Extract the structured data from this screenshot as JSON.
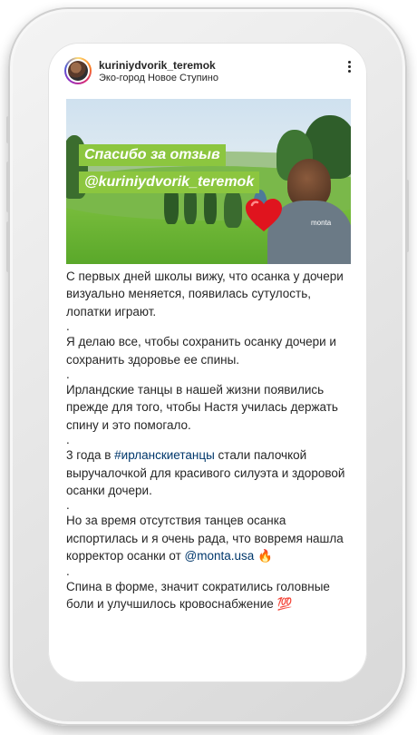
{
  "post": {
    "username": "kuriniydvorik_teremok",
    "location": "Эко-город Новое Ступино",
    "more_icon": "more-vertical-icon"
  },
  "photo": {
    "caption_line1": "Спасибо за отзыв",
    "caption_line2": "@kuriniydvorik_teremok",
    "shirt_logo": "monta",
    "caption_bg": "#8cc63f"
  },
  "caption": {
    "p1": "С первых дней школы вижу, что осанка у дочери визуально меняется, появилась сутулость, лопатки играют.",
    "sep": ".",
    "p2": "Я делаю все, чтобы сохранить осанку дочери и сохранить здоровье ее спины.",
    "p3": "Ирландские танцы в нашей жизни появились прежде для того, чтобы Настя училась держать спину и это помогало.",
    "p4_before": "3 года в ",
    "p4_hashtag": "#ирланскиетанцы",
    "p4_after": " стали палочкой выручалочкой для красивого силуэта и здоровой осанки дочери.",
    "p5_before": "Но за время отсутствия танцев осанка испортилась и я очень рада, что вовремя нашла корректор осанки от ",
    "p5_mention": "@monta.usa",
    "p5_emoji": "🔥",
    "p6": "Спина в форме, значит сократились головные боли и улучшилось кровоснабжение",
    "p6_emoji": "💯",
    "link_color": "#00376b"
  }
}
